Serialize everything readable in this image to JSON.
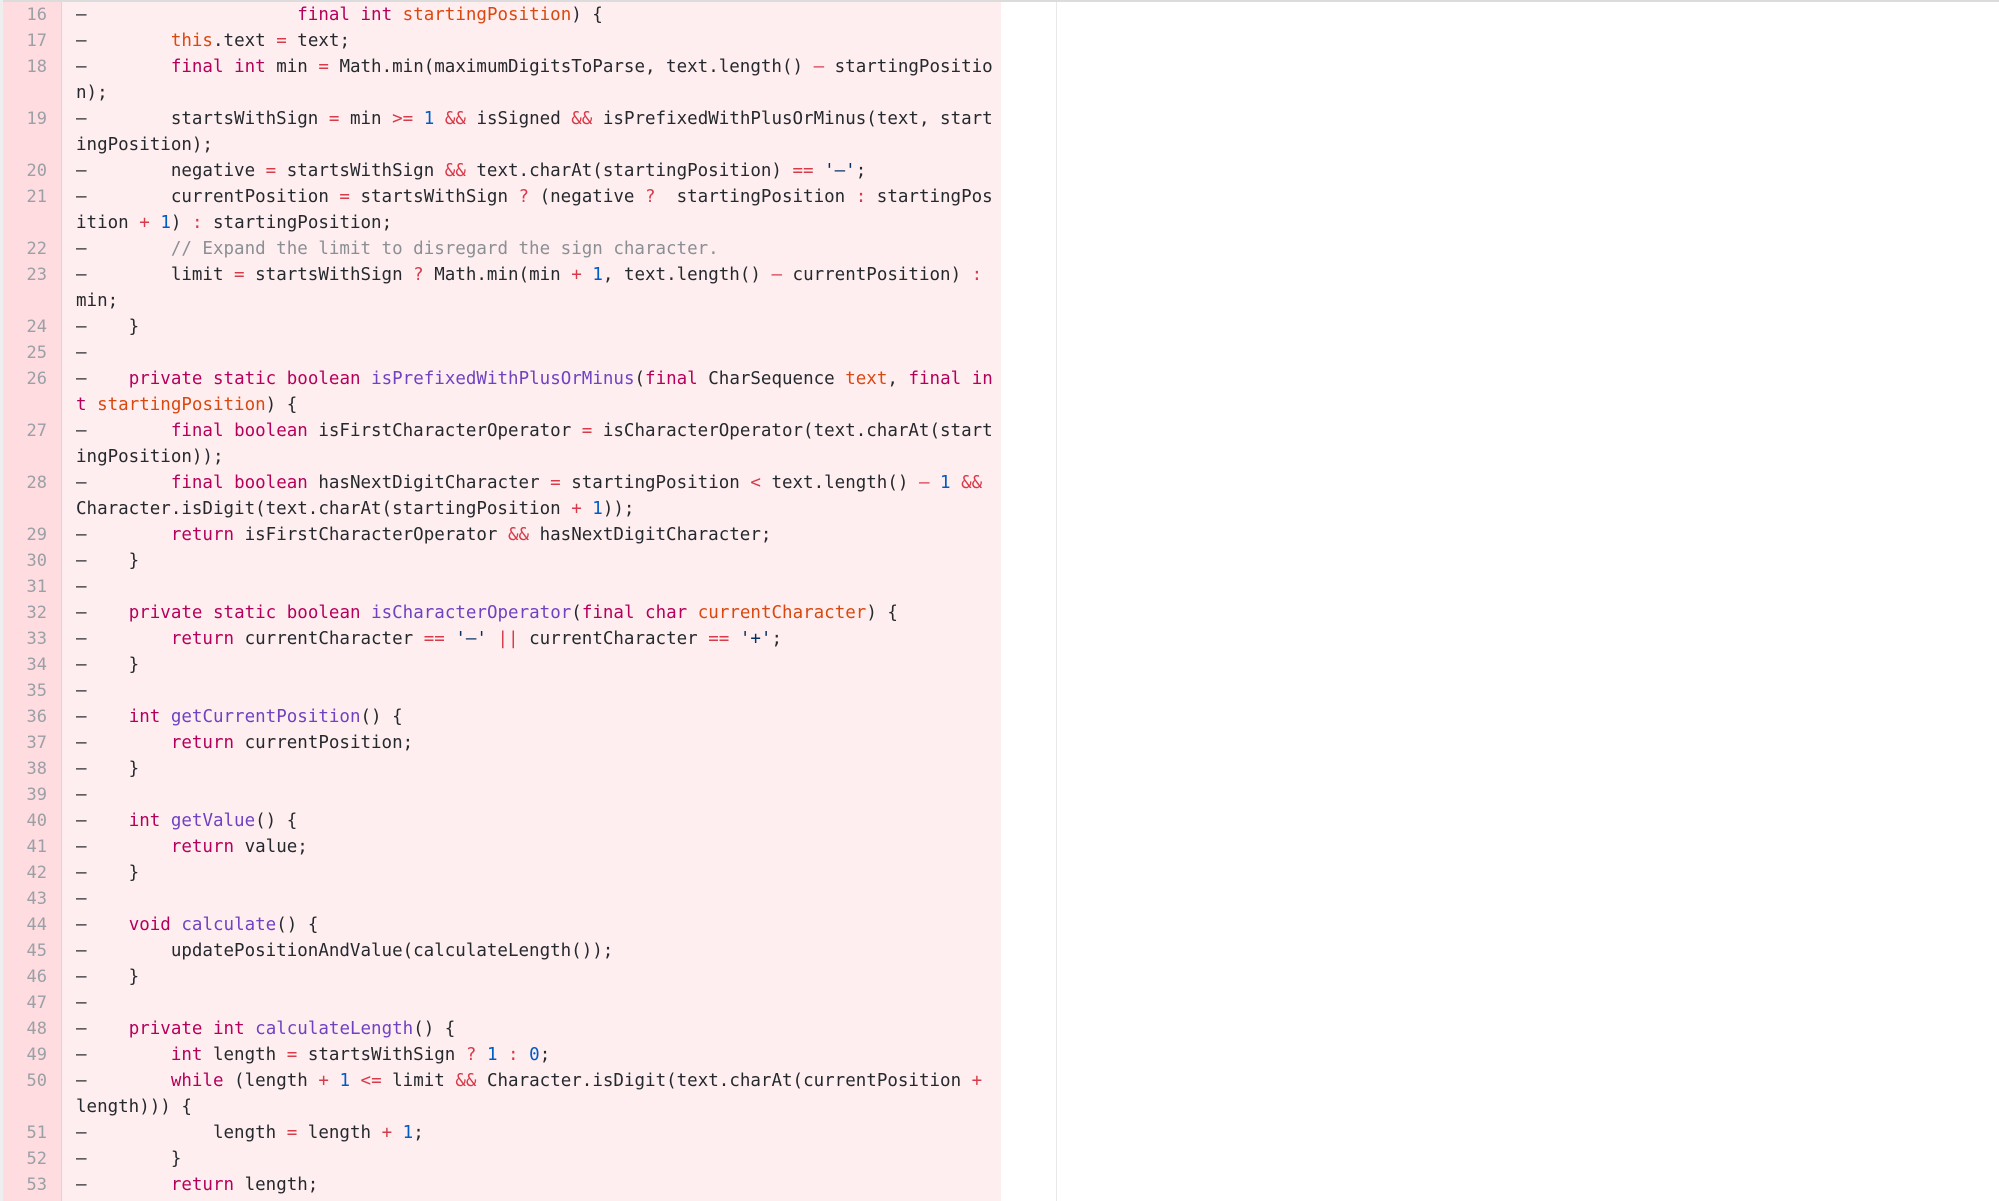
{
  "diff": {
    "lines": [
      {
        "n": "16",
        "code": [
          {
            "t": "–                    "
          },
          {
            "t": "final",
            "c": "k"
          },
          {
            "t": " "
          },
          {
            "t": "int",
            "c": "k"
          },
          {
            "t": " "
          },
          {
            "t": "startingPosition",
            "c": "ko"
          },
          {
            "t": ") {"
          }
        ]
      },
      {
        "n": "17",
        "code": [
          {
            "t": "–        "
          },
          {
            "t": "this",
            "c": "ko"
          },
          {
            "t": "."
          },
          {
            "t": "text "
          },
          {
            "t": "=",
            "c": "o"
          },
          {
            "t": " text;"
          }
        ]
      },
      {
        "n": "18",
        "code": [
          {
            "t": "–        "
          },
          {
            "t": "final",
            "c": "k"
          },
          {
            "t": " "
          },
          {
            "t": "int",
            "c": "k"
          },
          {
            "t": " min "
          },
          {
            "t": "=",
            "c": "o"
          },
          {
            "t": " Math.min(maximumDigitsToParse, text.length() "
          },
          {
            "t": "–",
            "c": "o"
          },
          {
            "t": " startingPosition);"
          }
        ]
      },
      {
        "n": "19",
        "code": [
          {
            "t": "–        startsWithSign "
          },
          {
            "t": "=",
            "c": "o"
          },
          {
            "t": " min "
          },
          {
            "t": ">=",
            "c": "o"
          },
          {
            "t": " "
          },
          {
            "t": "1",
            "c": "n"
          },
          {
            "t": " "
          },
          {
            "t": "&&",
            "c": "o"
          },
          {
            "t": " isSigned "
          },
          {
            "t": "&&",
            "c": "o"
          },
          {
            "t": " isPrefixedWithPlusOrMinus(text, startingPosition);"
          }
        ]
      },
      {
        "n": "20",
        "code": [
          {
            "t": "–        negative "
          },
          {
            "t": "=",
            "c": "o"
          },
          {
            "t": " startsWithSign "
          },
          {
            "t": "&&",
            "c": "o"
          },
          {
            "t": " text.charAt(startingPosition) "
          },
          {
            "t": "==",
            "c": "o"
          },
          {
            "t": " "
          },
          {
            "t": "'–'",
            "c": "s"
          },
          {
            "t": ";"
          }
        ]
      },
      {
        "n": "21",
        "code": [
          {
            "t": "–        currentPosition "
          },
          {
            "t": "=",
            "c": "o"
          },
          {
            "t": " startsWithSign "
          },
          {
            "t": "?",
            "c": "o"
          },
          {
            "t": " (negative "
          },
          {
            "t": "?",
            "c": "o"
          },
          {
            "t": "  startingPosition "
          },
          {
            "t": ":",
            "c": "o"
          },
          {
            "t": " startingPosition "
          },
          {
            "t": "+",
            "c": "o"
          },
          {
            "t": " "
          },
          {
            "t": "1",
            "c": "n"
          },
          {
            "t": ") "
          },
          {
            "t": ":",
            "c": "o"
          },
          {
            "t": " startingPosition;"
          }
        ]
      },
      {
        "n": "22",
        "code": [
          {
            "t": "–        "
          },
          {
            "t": "// Expand the limit to disregard the sign character.",
            "c": "c"
          }
        ]
      },
      {
        "n": "23",
        "code": [
          {
            "t": "–        limit "
          },
          {
            "t": "=",
            "c": "o"
          },
          {
            "t": " startsWithSign "
          },
          {
            "t": "?",
            "c": "o"
          },
          {
            "t": " Math.min(min "
          },
          {
            "t": "+",
            "c": "o"
          },
          {
            "t": " "
          },
          {
            "t": "1",
            "c": "n"
          },
          {
            "t": ", text.length() "
          },
          {
            "t": "–",
            "c": "o"
          },
          {
            "t": " currentPosition) "
          },
          {
            "t": ":",
            "c": "o"
          },
          {
            "t": " min;"
          }
        ]
      },
      {
        "n": "24",
        "code": [
          {
            "t": "–    }"
          }
        ]
      },
      {
        "n": "25",
        "code": [
          {
            "t": "–"
          }
        ]
      },
      {
        "n": "26",
        "code": [
          {
            "t": "–    "
          },
          {
            "t": "private",
            "c": "k"
          },
          {
            "t": " "
          },
          {
            "t": "static",
            "c": "k"
          },
          {
            "t": " "
          },
          {
            "t": "boolean",
            "c": "k"
          },
          {
            "t": " "
          },
          {
            "t": "isPrefixedWithPlusOrMinus",
            "c": "f"
          },
          {
            "t": "("
          },
          {
            "t": "final",
            "c": "k"
          },
          {
            "t": " CharSequence "
          },
          {
            "t": "text",
            "c": "ko"
          },
          {
            "t": ", "
          },
          {
            "t": "final",
            "c": "k"
          },
          {
            "t": " "
          },
          {
            "t": "int",
            "c": "k"
          },
          {
            "t": " "
          },
          {
            "t": "startingPosition",
            "c": "ko"
          },
          {
            "t": ") {"
          }
        ]
      },
      {
        "n": "27",
        "code": [
          {
            "t": "–        "
          },
          {
            "t": "final",
            "c": "k"
          },
          {
            "t": " "
          },
          {
            "t": "boolean",
            "c": "k"
          },
          {
            "t": " isFirstCharacterOperator "
          },
          {
            "t": "=",
            "c": "o"
          },
          {
            "t": " isCharacterOperator(text.charAt(startingPosition));"
          }
        ]
      },
      {
        "n": "28",
        "code": [
          {
            "t": "–        "
          },
          {
            "t": "final",
            "c": "k"
          },
          {
            "t": " "
          },
          {
            "t": "boolean",
            "c": "k"
          },
          {
            "t": " hasNextDigitCharacter "
          },
          {
            "t": "=",
            "c": "o"
          },
          {
            "t": " startingPosition "
          },
          {
            "t": "<",
            "c": "o"
          },
          {
            "t": " text.length() "
          },
          {
            "t": "–",
            "c": "o"
          },
          {
            "t": " "
          },
          {
            "t": "1",
            "c": "n"
          },
          {
            "t": " "
          },
          {
            "t": "&&",
            "c": "o"
          },
          {
            "t": " Character.isDigit(text.charAt(startingPosition "
          },
          {
            "t": "+",
            "c": "o"
          },
          {
            "t": " "
          },
          {
            "t": "1",
            "c": "n"
          },
          {
            "t": "));"
          }
        ]
      },
      {
        "n": "29",
        "code": [
          {
            "t": "–        "
          },
          {
            "t": "return",
            "c": "k"
          },
          {
            "t": " isFirstCharacterOperator "
          },
          {
            "t": "&&",
            "c": "o"
          },
          {
            "t": " hasNextDigitCharacter;"
          }
        ]
      },
      {
        "n": "30",
        "code": [
          {
            "t": "–    }"
          }
        ]
      },
      {
        "n": "31",
        "code": [
          {
            "t": "–"
          }
        ]
      },
      {
        "n": "32",
        "code": [
          {
            "t": "–    "
          },
          {
            "t": "private",
            "c": "k"
          },
          {
            "t": " "
          },
          {
            "t": "static",
            "c": "k"
          },
          {
            "t": " "
          },
          {
            "t": "boolean",
            "c": "k"
          },
          {
            "t": " "
          },
          {
            "t": "isCharacterOperator",
            "c": "f"
          },
          {
            "t": "("
          },
          {
            "t": "final",
            "c": "k"
          },
          {
            "t": " "
          },
          {
            "t": "char",
            "c": "k"
          },
          {
            "t": " "
          },
          {
            "t": "currentCharacter",
            "c": "ko"
          },
          {
            "t": ") {"
          }
        ]
      },
      {
        "n": "33",
        "code": [
          {
            "t": "–        "
          },
          {
            "t": "return",
            "c": "k"
          },
          {
            "t": " currentCharacter "
          },
          {
            "t": "==",
            "c": "o"
          },
          {
            "t": " "
          },
          {
            "t": "'–'",
            "c": "s"
          },
          {
            "t": " "
          },
          {
            "t": "||",
            "c": "o"
          },
          {
            "t": " currentCharacter "
          },
          {
            "t": "==",
            "c": "o"
          },
          {
            "t": " "
          },
          {
            "t": "'+'",
            "c": "s"
          },
          {
            "t": ";"
          }
        ]
      },
      {
        "n": "34",
        "code": [
          {
            "t": "–    }"
          }
        ]
      },
      {
        "n": "35",
        "code": [
          {
            "t": "–"
          }
        ]
      },
      {
        "n": "36",
        "code": [
          {
            "t": "–    "
          },
          {
            "t": "int",
            "c": "k"
          },
          {
            "t": " "
          },
          {
            "t": "getCurrentPosition",
            "c": "f"
          },
          {
            "t": "() {"
          }
        ]
      },
      {
        "n": "37",
        "code": [
          {
            "t": "–        "
          },
          {
            "t": "return",
            "c": "k"
          },
          {
            "t": " currentPosition;"
          }
        ]
      },
      {
        "n": "38",
        "code": [
          {
            "t": "–    }"
          }
        ]
      },
      {
        "n": "39",
        "code": [
          {
            "t": "–"
          }
        ]
      },
      {
        "n": "40",
        "code": [
          {
            "t": "–    "
          },
          {
            "t": "int",
            "c": "k"
          },
          {
            "t": " "
          },
          {
            "t": "getValue",
            "c": "f"
          },
          {
            "t": "() {"
          }
        ]
      },
      {
        "n": "41",
        "code": [
          {
            "t": "–        "
          },
          {
            "t": "return",
            "c": "k"
          },
          {
            "t": " value;"
          }
        ]
      },
      {
        "n": "42",
        "code": [
          {
            "t": "–    }"
          }
        ]
      },
      {
        "n": "43",
        "code": [
          {
            "t": "–"
          }
        ]
      },
      {
        "n": "44",
        "code": [
          {
            "t": "–    "
          },
          {
            "t": "void",
            "c": "k"
          },
          {
            "t": " "
          },
          {
            "t": "calculate",
            "c": "f"
          },
          {
            "t": "() {"
          }
        ]
      },
      {
        "n": "45",
        "code": [
          {
            "t": "–        updatePositionAndValue(calculateLength());"
          }
        ]
      },
      {
        "n": "46",
        "code": [
          {
            "t": "–    }"
          }
        ]
      },
      {
        "n": "47",
        "code": [
          {
            "t": "–"
          }
        ]
      },
      {
        "n": "48",
        "code": [
          {
            "t": "–    "
          },
          {
            "t": "private",
            "c": "k"
          },
          {
            "t": " "
          },
          {
            "t": "int",
            "c": "k"
          },
          {
            "t": " "
          },
          {
            "t": "calculateLength",
            "c": "f"
          },
          {
            "t": "() {"
          }
        ]
      },
      {
        "n": "49",
        "code": [
          {
            "t": "–        "
          },
          {
            "t": "int",
            "c": "k"
          },
          {
            "t": " length "
          },
          {
            "t": "=",
            "c": "o"
          },
          {
            "t": " startsWithSign "
          },
          {
            "t": "?",
            "c": "o"
          },
          {
            "t": " "
          },
          {
            "t": "1",
            "c": "n"
          },
          {
            "t": " "
          },
          {
            "t": ":",
            "c": "o"
          },
          {
            "t": " "
          },
          {
            "t": "0",
            "c": "n"
          },
          {
            "t": ";"
          }
        ]
      },
      {
        "n": "50",
        "code": [
          {
            "t": "–        "
          },
          {
            "t": "while",
            "c": "k"
          },
          {
            "t": " (length "
          },
          {
            "t": "+",
            "c": "o"
          },
          {
            "t": " "
          },
          {
            "t": "1",
            "c": "n"
          },
          {
            "t": " "
          },
          {
            "t": "<=",
            "c": "o"
          },
          {
            "t": " limit "
          },
          {
            "t": "&&",
            "c": "o"
          },
          {
            "t": " Character.isDigit(text.charAt(currentPosition "
          },
          {
            "t": "+",
            "c": "o"
          },
          {
            "t": " length))) {"
          }
        ]
      },
      {
        "n": "51",
        "code": [
          {
            "t": "–            length "
          },
          {
            "t": "=",
            "c": "o"
          },
          {
            "t": " length "
          },
          {
            "t": "+",
            "c": "o"
          },
          {
            "t": " "
          },
          {
            "t": "1",
            "c": "n"
          },
          {
            "t": ";"
          }
        ]
      },
      {
        "n": "52",
        "code": [
          {
            "t": "–        }"
          }
        ]
      },
      {
        "n": "53",
        "code": [
          {
            "t": "–        "
          },
          {
            "t": "return",
            "c": "k"
          },
          {
            "t": " length;"
          }
        ]
      }
    ]
  }
}
